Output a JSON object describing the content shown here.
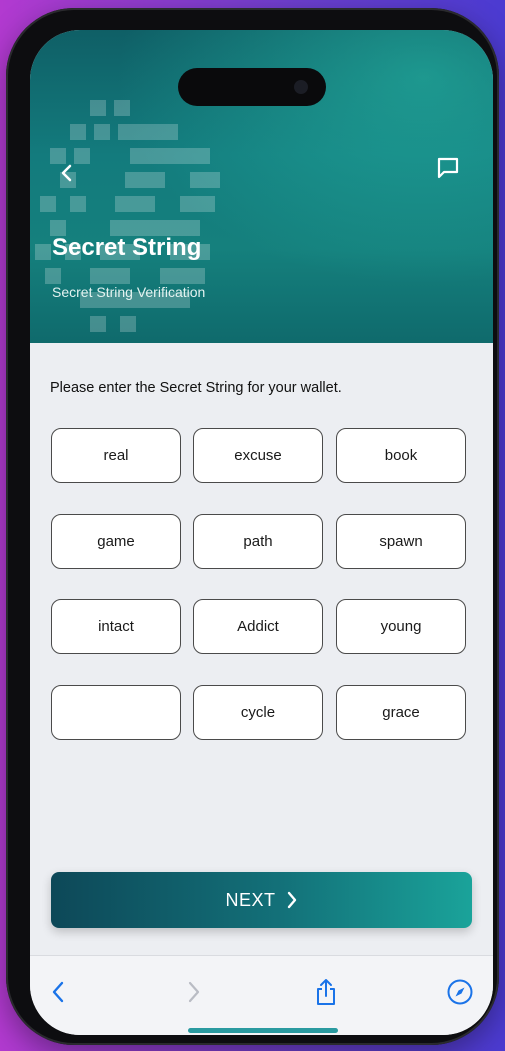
{
  "header": {
    "title": "Secret String",
    "subtitle": "Secret String Verification",
    "back_icon": "chevron-left-icon",
    "chat_icon": "chat-bubble-icon"
  },
  "main": {
    "instruction": "Please enter the Secret String for your wallet.",
    "words": [
      "real",
      "excuse",
      "book",
      "game",
      "path",
      "spawn",
      "intact",
      "Addict",
      "young",
      "",
      "cycle",
      "grace"
    ]
  },
  "next_button": {
    "label": "NEXT",
    "icon": "chevron-right-icon"
  },
  "browser_toolbar": {
    "icons": [
      "back-arrow-icon",
      "forward-arrow-icon",
      "share-icon",
      "compass-icon"
    ]
  },
  "colors": {
    "header_teal": "#137b7d",
    "button_gradient_start": "#0d4858",
    "button_gradient_end": "#1aa39a",
    "toolbar_blue": "#1a73e8"
  }
}
